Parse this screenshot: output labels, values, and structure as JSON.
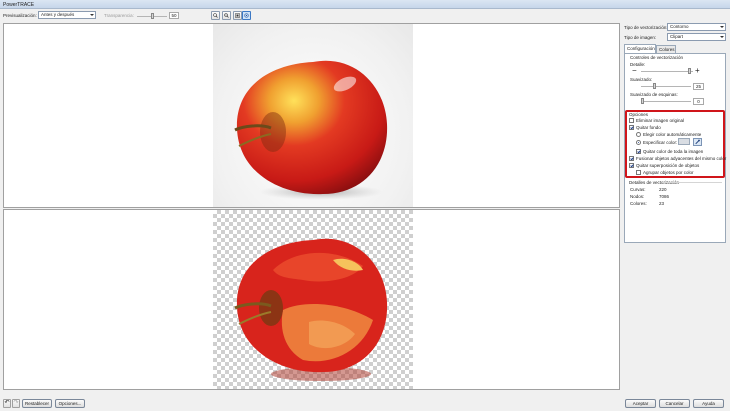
{
  "window": {
    "title": "PowerTRACE"
  },
  "toolbar": {
    "preview_label": "Previsualización:",
    "preview_value": "Antes y después",
    "transparency_label": "Transparencia:",
    "transparency_value": "50",
    "transparency_level": 0.5
  },
  "right_panel": {
    "trace_type_label": "Tipo de vectorización:",
    "trace_type_value": "Contorno",
    "image_type_label": "Tipo de imagen:",
    "image_type_value": "Clipart",
    "tabs": [
      {
        "label": "Configuración",
        "selected": true
      },
      {
        "label": "Colores",
        "selected": false
      }
    ],
    "controls": {
      "heading": "Controles de vectorización",
      "detail_label": "Detalle:",
      "detail_level": 0.9,
      "smoothing_label": "Suavizado:",
      "smoothing_value": "25",
      "smoothing_level": 0.25,
      "corner_label": "Suavizado de esquinas:",
      "corner_value": "0",
      "corner_level": 0.0
    },
    "options": {
      "heading": "Opciones",
      "delete_original": "Eliminar imagen original",
      "remove_background": "Quitar fondo",
      "auto_color": "Elegir color automáticamente",
      "specify_color": "Especificar color:",
      "remove_from_all": "Quitar color de toda la imagen",
      "merge_adjacent": "Fusionar objetos adyacentes del mismo color",
      "remove_overlap": "Quitar superposición de objetos",
      "group_by_color": "Agrupar objetos por color"
    },
    "details": {
      "heading": "Detalles de vectorización",
      "rows": [
        {
          "label": "Curvas:",
          "value": "220"
        },
        {
          "label": "Nodos:",
          "value": "7086"
        },
        {
          "label": "Colores:",
          "value": "23"
        }
      ]
    }
  },
  "bottom": {
    "reset_label": "Restablecer",
    "options_label": "Opciones...",
    "accept_label": "Aceptar",
    "cancel_label": "Cancelar",
    "help_label": "Ayuda"
  },
  "colors": {
    "highlight_box": "#d0151a",
    "apple_red": "#d8241c"
  }
}
